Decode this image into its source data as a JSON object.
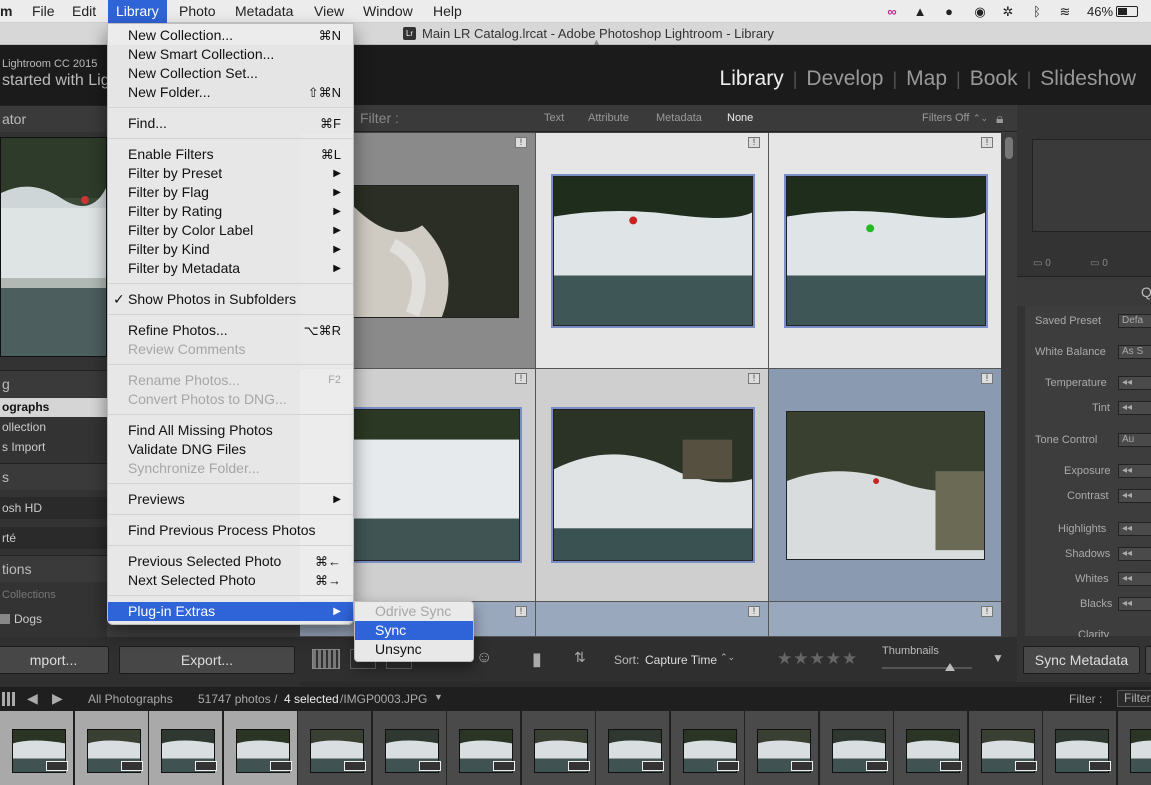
{
  "menubar": {
    "app_fragment": "m",
    "items": [
      "File",
      "Edit",
      "Library",
      "Photo",
      "Metadata",
      "View",
      "Window",
      "Help"
    ],
    "battery": "46%"
  },
  "window": {
    "title": "Main LR Catalog.lrcat - Adobe Photoshop Lightroom - Library"
  },
  "identity": {
    "line1": "Lightroom CC 2015",
    "line2": "started with Lig"
  },
  "modules": [
    "Library",
    "Develop",
    "Map",
    "Book",
    "Slideshow"
  ],
  "left_panel": {
    "navigator_header": "ator",
    "catalog_header": "g",
    "catalog_items": [
      "ographs",
      "ollection",
      "s Import"
    ],
    "folders_header": "s",
    "volumes": [
      "osh HD",
      "rté"
    ],
    "collections_header": "tions",
    "collections_filter": "Collections",
    "collection_item": "Dogs",
    "import_label": "mport...",
    "export_label": "Export..."
  },
  "filter_bar": {
    "title": "Filter :",
    "tabs": [
      "Text",
      "Attribute",
      "Metadata",
      "None"
    ],
    "state": "Filters Off"
  },
  "toolbar": {
    "sort_label": "Sort:",
    "sort_value": "Capture Time",
    "thumbnails_label": "Thumbnails",
    "thumbnail_size": 0.75
  },
  "right_panel": {
    "quick_develop_fragment": "Q",
    "saved_preset": "Saved Preset",
    "saved_preset_value": "Defa",
    "white_balance": "White Balance",
    "white_balance_value": "As S",
    "temperature": "Temperature",
    "tint": "Tint",
    "tone_control": "Tone Control",
    "tone_value": "Au",
    "exposure": "Exposure",
    "contrast": "Contrast",
    "highlights": "Highlights",
    "shadows": "Shadows",
    "whites": "Whites",
    "blacks": "Blacks",
    "clarity": "Clarity",
    "histogram_count_1": "0",
    "histogram_count_2": "0",
    "sync_metadata": "Sync Metadata"
  },
  "filmstrip_bar": {
    "source": "All Photographs",
    "count": "51747 photos /",
    "selected": "4 selected",
    "file": "/IMGP0003.JPG",
    "filter_label": "Filter :",
    "filter_value": "Filter"
  },
  "library_menu": [
    {
      "label": "New Collection...",
      "shortcut": "⌘N"
    },
    {
      "label": "New Smart Collection...",
      "shortcut": ""
    },
    {
      "label": "New Collection Set...",
      "shortcut": ""
    },
    {
      "label": "New Folder...",
      "shortcut": "⇧⌘N"
    },
    {
      "label": "Find...",
      "shortcut": "⌘F"
    },
    {
      "label": "Enable Filters",
      "shortcut": "⌘L"
    },
    {
      "label": "Filter by Preset",
      "shortcut": ""
    },
    {
      "label": "Filter by Flag",
      "shortcut": ""
    },
    {
      "label": "Filter by Rating",
      "shortcut": ""
    },
    {
      "label": "Filter by Color Label",
      "shortcut": ""
    },
    {
      "label": "Filter by Kind",
      "shortcut": ""
    },
    {
      "label": "Filter by Metadata",
      "shortcut": ""
    },
    {
      "label": "Show Photos in Subfolders",
      "shortcut": ""
    },
    {
      "label": "Refine Photos...",
      "shortcut": "⌥⌘R"
    },
    {
      "label": "Review Comments",
      "shortcut": ""
    },
    {
      "label": "Rename Photos...",
      "shortcut": "F2"
    },
    {
      "label": "Convert Photos to DNG...",
      "shortcut": ""
    },
    {
      "label": "Find All Missing Photos",
      "shortcut": ""
    },
    {
      "label": "Validate DNG Files",
      "shortcut": ""
    },
    {
      "label": "Synchronize Folder...",
      "shortcut": ""
    },
    {
      "label": "Previews",
      "shortcut": ""
    },
    {
      "label": "Find Previous Process Photos",
      "shortcut": ""
    },
    {
      "label": "Previous Selected Photo",
      "shortcut": "⌘←"
    },
    {
      "label": "Next Selected Photo",
      "shortcut": "⌘→"
    },
    {
      "label": "Plug-in Extras",
      "shortcut": ""
    }
  ],
  "plugin_submenu": [
    "Odrive Sync",
    "Sync",
    "Unsync"
  ],
  "colors": {
    "menu_highlight": "#2f63d8",
    "selection_outline": "#7c8ec9"
  }
}
